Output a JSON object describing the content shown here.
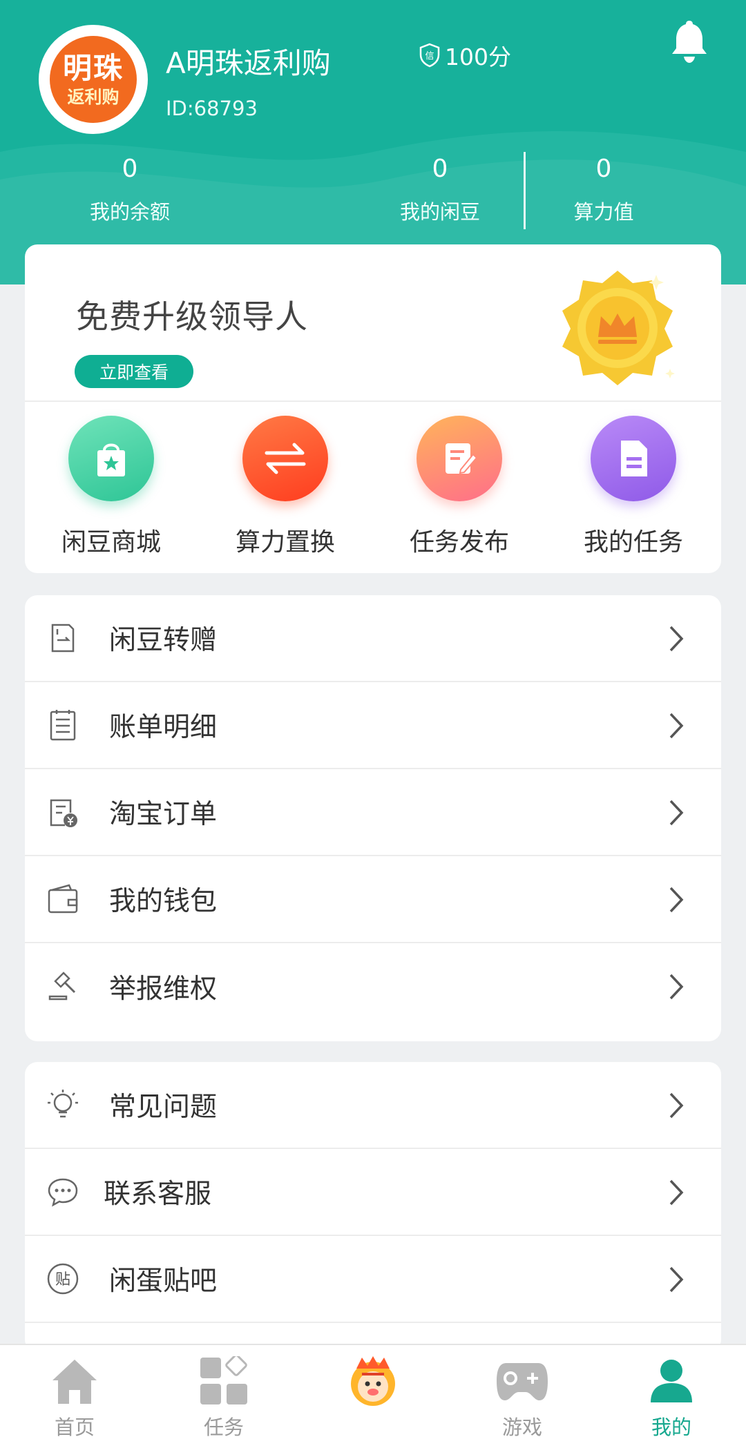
{
  "profile": {
    "avatar_text_line1": "明珠",
    "avatar_text_line2": "返利购",
    "name": "A明珠返利购",
    "id_text": "ID:68793",
    "credit_icon_text": "信",
    "credit": "100分"
  },
  "stats": [
    {
      "value": "0",
      "label": "我的余额"
    },
    {
      "value": "0",
      "label": "我的闲豆"
    },
    {
      "value": "0",
      "label": "算力值"
    }
  ],
  "promo": {
    "title": "免费升级领导人",
    "button": "立即查看"
  },
  "quick_actions": [
    {
      "label": "闲豆商城",
      "icon": "shopping-bag-icon",
      "color": "#3ccf9f"
    },
    {
      "label": "算力置换",
      "icon": "swap-arrows-icon",
      "color": "#ff5a2c"
    },
    {
      "label": "任务发布",
      "icon": "edit-note-icon",
      "color": "#ff8a7a"
    },
    {
      "label": "我的任务",
      "icon": "document-icon",
      "color": "#a56ff0"
    }
  ],
  "menu_group1": [
    {
      "label": "闲豆转赠",
      "icon": "transfer-doc-icon"
    },
    {
      "label": "账单明细",
      "icon": "bill-list-icon"
    },
    {
      "label": "淘宝订单",
      "icon": "order-yen-icon"
    },
    {
      "label": "我的钱包",
      "icon": "wallet-icon"
    },
    {
      "label": "举报维权",
      "icon": "gavel-icon"
    }
  ],
  "menu_group2": [
    {
      "label": "常见问题",
      "icon": "lightbulb-icon"
    },
    {
      "label": "联系客服",
      "icon": "chat-bubble-icon"
    },
    {
      "label": "闲蛋贴吧",
      "icon": "forum-tie-icon",
      "icon_text": "贴"
    }
  ],
  "tabs": [
    {
      "label": "首页",
      "icon": "home-icon"
    },
    {
      "label": "任务",
      "icon": "grid-icon"
    },
    {
      "label": "",
      "icon": "lion-mascot-icon"
    },
    {
      "label": "游戏",
      "icon": "gamepad-icon"
    },
    {
      "label": "我的",
      "icon": "user-icon",
      "active": true
    }
  ],
  "colors": {
    "brand_teal": "#17b19b",
    "active_tab": "#17a88f",
    "badge_gold": "#f6c832"
  }
}
